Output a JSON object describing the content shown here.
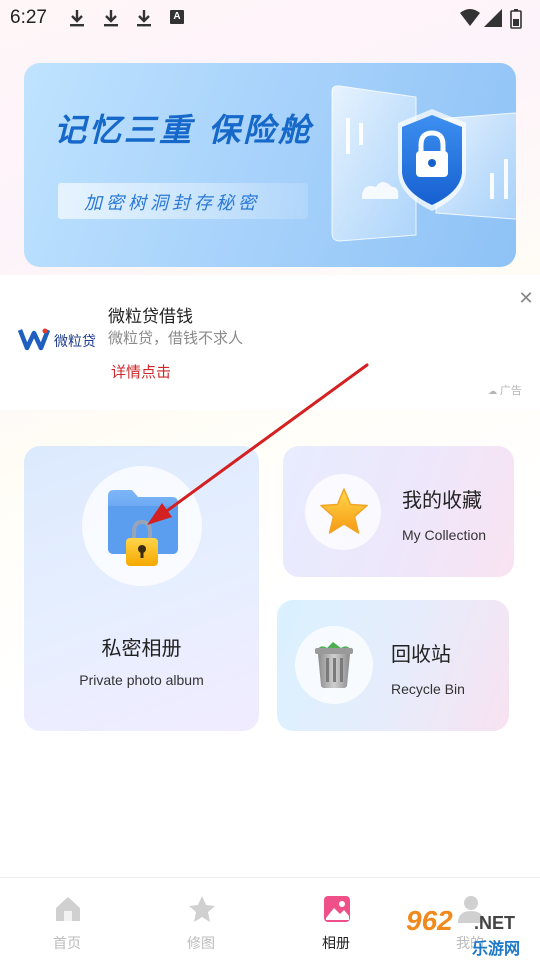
{
  "status_bar": {
    "time": "6:27",
    "download_icons": [
      "download-icon",
      "download-icon",
      "download-icon"
    ],
    "notification_icon_letter": "A"
  },
  "banner": {
    "title": "记忆三重 保险舱",
    "subtitle": "加密树洞封存秘密"
  },
  "ad": {
    "logo_text": "微粒贷",
    "title": "微粒贷借钱",
    "description": "微粒贷，借钱不求人",
    "link": "详情点击",
    "close": "✕",
    "tag": "广告"
  },
  "cards": {
    "private_album": {
      "title_cn": "私密相册",
      "title_en": "Private photo album"
    },
    "collection": {
      "title_cn": "我的收藏",
      "title_en": "My Collection"
    },
    "recycle_bin": {
      "title_cn": "回收站",
      "title_en": "Recycle Bin"
    }
  },
  "bottom_nav": {
    "items": [
      {
        "label": "首页",
        "icon": "home-icon",
        "active": false
      },
      {
        "label": "修图",
        "icon": "star-edit-icon",
        "active": false
      },
      {
        "label": "相册",
        "icon": "album-icon",
        "active": true
      },
      {
        "label": "我的",
        "icon": "profile-icon",
        "active": false
      }
    ]
  },
  "watermark": {
    "number": "962",
    "domain": ".NET",
    "site": "乐游网"
  },
  "colors": {
    "banner_title": "#1668c9",
    "ad_link": "#d0282a",
    "nav_active": "#f0508a",
    "nav_inactive": "#bcbcbc",
    "arrow": "#d42020"
  }
}
